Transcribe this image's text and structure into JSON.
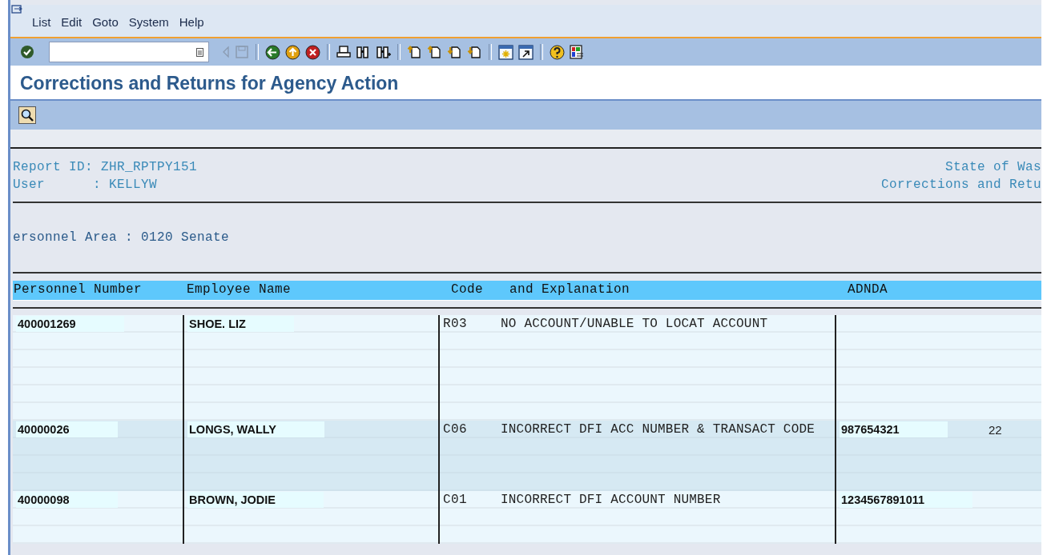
{
  "menu": [
    "List",
    "Edit",
    "Goto",
    "System",
    "Help"
  ],
  "title": "Corrections and Returns for Agency Action",
  "report_header": {
    "left": [
      "Report ID: ZHR_RPTPY151",
      "User      : KELLYW"
    ],
    "right": [
      "State of Was",
      "Corrections and Retu"
    ]
  },
  "area_line": "ersonnel Area : 0120 Senate",
  "table": {
    "columns": [
      "Personnel Number",
      "Employee Name",
      "Code",
      "and Explanation",
      "ADNDA"
    ],
    "rows": [
      {
        "number": "400001269",
        "name": "SHOE. LIZ",
        "code": "R03",
        "explanation": "NO ACCOUNT/UNABLE TO LOCAT ACCOUNT"
      },
      {
        "number": "40000026",
        "name": "LONGS, WALLY",
        "code": "C06",
        "explanation": "INCORRECT DFI ACC NUMBER & TRANSACT CODE",
        "adnda": "987654321",
        "column_6": "22"
      },
      {
        "number": "40000098",
        "name": "BROWN, JODIE",
        "code": "C01",
        "explanation": "INCORRECT DFI ACCOUNT NUMBER",
        "adnda": "1234567891011"
      }
    ]
  }
}
